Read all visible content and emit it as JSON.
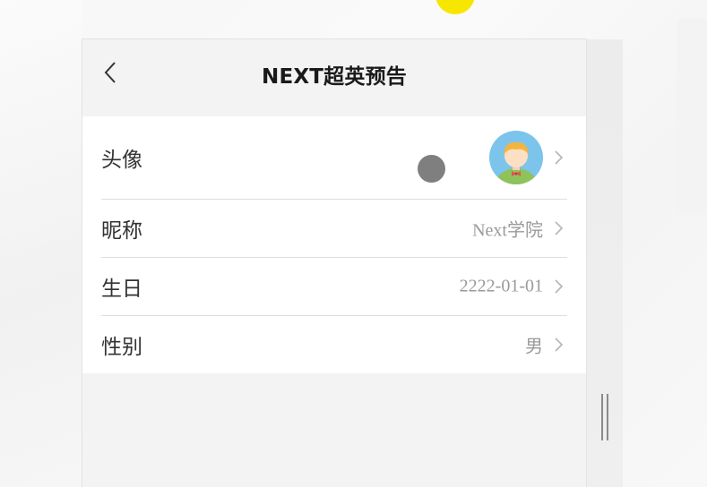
{
  "header": {
    "title": "NEXT超英预告",
    "back_icon": "chevron-left-icon"
  },
  "profile": {
    "items": [
      {
        "label": "头像",
        "value": "",
        "type": "avatar",
        "icon": "avatar-image"
      },
      {
        "label": "昵称",
        "value": "Next学院"
      },
      {
        "label": "生日",
        "value": "2222-01-01"
      },
      {
        "label": "性别",
        "value": "男"
      }
    ],
    "chevron_icon": "chevron-right-icon"
  },
  "colors": {
    "background": "#f3f3f3",
    "list_background": "#ffffff",
    "label_text": "#333333",
    "value_text": "#9a9a9a",
    "cursor_highlight": "#f7e600",
    "touch_indicator": "#7f7f7f"
  }
}
